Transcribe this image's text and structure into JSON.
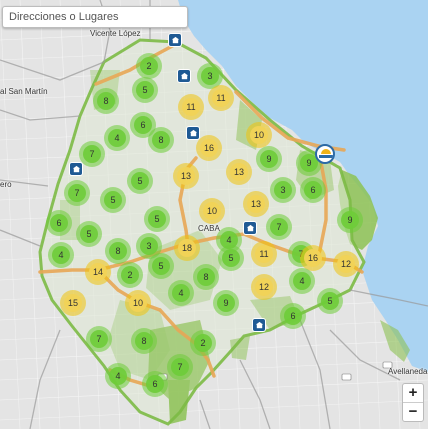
{
  "search": {
    "placeholder": "Direcciones o Lugares"
  },
  "places": {
    "vicente_lopez": "Vicente López",
    "san_martin": "al San Martín",
    "caba": "CABA",
    "avellaneda": "Avellaneda",
    "left_edge": "ero"
  },
  "clusters": [
    {
      "count": "2",
      "color": "green"
    },
    {
      "count": "3",
      "color": "green"
    },
    {
      "count": "5",
      "color": "green"
    },
    {
      "count": "8",
      "color": "green"
    },
    {
      "count": "11",
      "color": "yellow"
    },
    {
      "count": "11",
      "color": "yellow"
    },
    {
      "count": "4",
      "color": "green"
    },
    {
      "count": "6",
      "color": "green"
    },
    {
      "count": "8",
      "color": "green"
    },
    {
      "count": "10",
      "color": "yellow"
    },
    {
      "count": "7",
      "color": "green"
    },
    {
      "count": "16",
      "color": "yellow"
    },
    {
      "count": "9",
      "color": "green"
    },
    {
      "count": "9",
      "color": "green"
    },
    {
      "count": "5",
      "color": "green"
    },
    {
      "count": "13",
      "color": "yellow"
    },
    {
      "count": "13",
      "color": "yellow"
    },
    {
      "count": "7",
      "color": "green"
    },
    {
      "count": "5",
      "color": "green"
    },
    {
      "count": "3",
      "color": "green"
    },
    {
      "count": "6",
      "color": "green"
    },
    {
      "count": "10",
      "color": "yellow"
    },
    {
      "count": "13",
      "color": "yellow"
    },
    {
      "count": "6",
      "color": "green"
    },
    {
      "count": "5",
      "color": "green"
    },
    {
      "count": "5",
      "color": "green"
    },
    {
      "count": "9",
      "color": "green"
    },
    {
      "count": "4",
      "color": "green"
    },
    {
      "count": "8",
      "color": "green"
    },
    {
      "count": "3",
      "color": "green"
    },
    {
      "count": "18",
      "color": "yellow"
    },
    {
      "count": "7",
      "color": "green"
    },
    {
      "count": "4",
      "color": "green"
    },
    {
      "count": "5",
      "color": "green"
    },
    {
      "count": "11",
      "color": "yellow"
    },
    {
      "count": "14",
      "color": "yellow"
    },
    {
      "count": "2",
      "color": "green"
    },
    {
      "count": "5",
      "color": "green"
    },
    {
      "count": "8",
      "color": "green"
    },
    {
      "count": "7",
      "color": "green"
    },
    {
      "count": "16",
      "color": "yellow"
    },
    {
      "count": "12",
      "color": "yellow"
    },
    {
      "count": "15",
      "color": "yellow"
    },
    {
      "count": "10",
      "color": "yellow"
    },
    {
      "count": "4",
      "color": "green"
    },
    {
      "count": "12",
      "color": "yellow"
    },
    {
      "count": "4",
      "color": "green"
    },
    {
      "count": "9",
      "color": "green"
    },
    {
      "count": "5",
      "color": "green"
    },
    {
      "count": "6",
      "color": "green"
    },
    {
      "count": "7",
      "color": "green"
    },
    {
      "count": "8",
      "color": "green"
    },
    {
      "count": "2",
      "color": "green"
    },
    {
      "count": "7",
      "color": "green"
    },
    {
      "count": "4",
      "color": "green"
    },
    {
      "count": "6",
      "color": "green"
    }
  ],
  "zoom": {
    "in": "+",
    "out": "−"
  },
  "colors": {
    "water": "#aad3f2",
    "park": "#8dc255",
    "highway": "#e8a756",
    "cluster_green": "#6ecc39",
    "cluster_yellow": "#f0c20c",
    "marker": "#1f5a94"
  }
}
